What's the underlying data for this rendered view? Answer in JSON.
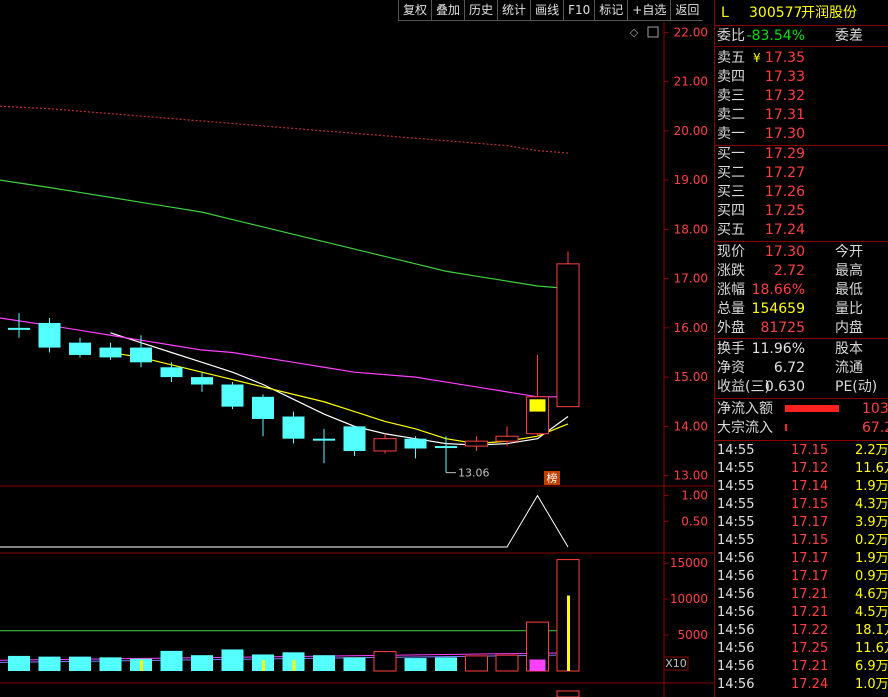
{
  "toolbar": {
    "items": [
      "复权",
      "叠加",
      "历史",
      "统计",
      "画线",
      "F10",
      "标记",
      "+自选",
      "返回"
    ]
  },
  "stock": {
    "flag": "L",
    "code": "300577",
    "name": "开润股份"
  },
  "order_ratio": {
    "label": "委比",
    "value": "-83.54%",
    "label2": "委差"
  },
  "asks": [
    {
      "label": "卖五",
      "mark": "¥",
      "price": "17.35"
    },
    {
      "label": "卖四",
      "price": "17.33"
    },
    {
      "label": "卖三",
      "price": "17.32"
    },
    {
      "label": "卖二",
      "price": "17.31"
    },
    {
      "label": "卖一",
      "price": "17.30"
    }
  ],
  "bids": [
    {
      "label": "买一",
      "price": "17.29"
    },
    {
      "label": "买二",
      "price": "17.27"
    },
    {
      "label": "买三",
      "price": "17.26"
    },
    {
      "label": "买四",
      "price": "17.25"
    },
    {
      "label": "买五",
      "price": "17.24"
    }
  ],
  "quote": [
    {
      "label": "现价",
      "value": "17.30",
      "label2": "今开",
      "color": "red"
    },
    {
      "label": "涨跌",
      "value": "2.72",
      "label2": "最高",
      "color": "red"
    },
    {
      "label": "涨幅",
      "value": "18.66%",
      "label2": "最低",
      "color": "red"
    },
    {
      "label": "总量",
      "value": "154659",
      "label2": "量比",
      "color": "yellow"
    },
    {
      "label": "外盘",
      "value": "81725",
      "label2": "内盘",
      "color": "red"
    }
  ],
  "fundamentals": [
    {
      "label": "换手",
      "value": "11.96%",
      "label2": "股本"
    },
    {
      "label": "净资",
      "value": "6.72",
      "label2": "流通"
    },
    {
      "label": "收益(三)",
      "value": "0.630",
      "label2": "PE(动)"
    }
  ],
  "flows": [
    {
      "label": "净流入额",
      "value": "103"
    },
    {
      "label": "大宗流入",
      "value": "67.2"
    }
  ],
  "ticks": [
    {
      "time": "14:55",
      "price": "17.15",
      "vol": "2.2万"
    },
    {
      "time": "14:55",
      "price": "17.12",
      "vol": "11.6万"
    },
    {
      "time": "14:55",
      "price": "17.14",
      "vol": "1.9万"
    },
    {
      "time": "14:55",
      "price": "17.15",
      "vol": "4.3万"
    },
    {
      "time": "14:55",
      "price": "17.17",
      "vol": "3.9万"
    },
    {
      "time": "14:55",
      "price": "17.15",
      "vol": "0.2万"
    },
    {
      "time": "14:56",
      "price": "17.17",
      "vol": "1.9万"
    },
    {
      "time": "14:56",
      "price": "17.17",
      "vol": "0.9万"
    },
    {
      "time": "14:56",
      "price": "17.21",
      "vol": "4.6万"
    },
    {
      "time": "14:56",
      "price": "17.21",
      "vol": "4.5万"
    },
    {
      "time": "14:56",
      "price": "17.22",
      "vol": "18.1万"
    },
    {
      "time": "14:56",
      "price": "17.25",
      "vol": "11.6万"
    },
    {
      "time": "14:56",
      "price": "17.21",
      "vol": "6.9万"
    },
    {
      "time": "14:56",
      "price": "17.24",
      "vol": "1.0万"
    }
  ],
  "chart_data": {
    "type": "candlestick",
    "price_axis": {
      "ticks": [
        22.0,
        21.0,
        20.0,
        19.0,
        18.0,
        17.0,
        16.0,
        15.0,
        14.0,
        13.0
      ],
      "range": [
        12.85,
        22.15
      ]
    },
    "low_annotation": "13.06",
    "badge": "榜",
    "candles": [
      {
        "o": 16.0,
        "c": 16.0,
        "h": 16.3,
        "l": 15.8,
        "up": false
      },
      {
        "o": 16.1,
        "c": 15.6,
        "h": 16.2,
        "l": 15.5,
        "up": false
      },
      {
        "o": 15.7,
        "c": 15.45,
        "h": 15.8,
        "l": 15.4,
        "up": false
      },
      {
        "o": 15.6,
        "c": 15.4,
        "h": 15.7,
        "l": 15.35,
        "up": false
      },
      {
        "o": 15.6,
        "c": 15.3,
        "h": 15.85,
        "l": 15.2,
        "up": false
      },
      {
        "o": 15.2,
        "c": 15.0,
        "h": 15.3,
        "l": 14.9,
        "up": false
      },
      {
        "o": 15.0,
        "c": 14.85,
        "h": 15.1,
        "l": 14.7,
        "up": false
      },
      {
        "o": 14.85,
        "c": 14.4,
        "h": 14.9,
        "l": 14.35,
        "up": false
      },
      {
        "o": 14.6,
        "c": 14.15,
        "h": 14.65,
        "l": 13.8,
        "up": false
      },
      {
        "o": 14.2,
        "c": 13.75,
        "h": 14.3,
        "l": 13.65,
        "up": false
      },
      {
        "o": 13.75,
        "c": 13.75,
        "h": 13.95,
        "l": 13.25,
        "up": false
      },
      {
        "o": 14.0,
        "c": 13.5,
        "h": 14.0,
        "l": 13.4,
        "up": false
      },
      {
        "o": 13.5,
        "c": 13.75,
        "h": 13.85,
        "l": 13.45,
        "up": true
      },
      {
        "o": 13.75,
        "c": 13.55,
        "h": 13.8,
        "l": 13.35,
        "up": false
      },
      {
        "o": 13.6,
        "c": 13.6,
        "h": 13.8,
        "l": 13.06,
        "up": false
      },
      {
        "o": 13.6,
        "c": 13.7,
        "h": 13.8,
        "l": 13.5,
        "up": true
      },
      {
        "o": 13.7,
        "c": 13.8,
        "h": 14.0,
        "l": 13.6,
        "up": true
      },
      {
        "o": 13.85,
        "c": 14.6,
        "h": 15.45,
        "l": 13.8,
        "up": true
      },
      {
        "o": 14.4,
        "c": 17.3,
        "h": 17.55,
        "l": 14.4,
        "up": true
      }
    ],
    "ma": [
      {
        "name": "MA-white",
        "color": "#ffffff",
        "values": [
          null,
          null,
          null,
          15.9,
          15.7,
          15.5,
          15.3,
          15.1,
          14.85,
          14.55,
          14.25,
          14.0,
          13.85,
          13.75,
          13.65,
          13.62,
          13.65,
          13.75,
          14.2
        ]
      },
      {
        "name": "MA-yellow",
        "color": "#ffff00",
        "values": [
          null,
          null,
          null,
          15.5,
          15.4,
          15.25,
          15.1,
          14.95,
          14.8,
          14.65,
          14.5,
          14.3,
          14.1,
          13.95,
          13.75,
          13.65,
          13.7,
          13.8,
          14.05
        ]
      },
      {
        "name": "MA-magenta",
        "color": "#ff40ff",
        "values": [
          16.2,
          16.05,
          15.95,
          15.85,
          15.75,
          15.65,
          15.55,
          15.5,
          15.4,
          15.3,
          15.2,
          15.1,
          15.05,
          15.0,
          14.9,
          14.8,
          14.7,
          14.6,
          14.6
        ]
      },
      {
        "name": "MA-green",
        "color": "#40d040",
        "values": [
          19.0,
          18.85,
          18.75,
          18.65,
          18.55,
          18.45,
          18.35,
          18.2,
          18.05,
          17.9,
          17.75,
          17.6,
          17.45,
          17.3,
          17.15,
          17.05,
          16.95,
          16.85,
          16.8
        ]
      },
      {
        "name": "MA-red",
        "color": "#c03030",
        "values": [
          20.5,
          20.45,
          20.4,
          20.35,
          20.3,
          20.25,
          20.2,
          20.15,
          20.1,
          20.05,
          20.0,
          19.95,
          19.9,
          19.85,
          19.8,
          19.75,
          19.7,
          19.6,
          19.55
        ]
      }
    ],
    "indicator": {
      "ticks": [
        1.0,
        0.5
      ],
      "values": [
        0,
        0,
        0,
        0,
        0,
        0,
        0,
        0,
        0,
        0,
        0,
        0,
        0,
        0,
        0,
        0,
        0,
        1.0,
        0
      ]
    },
    "volume": {
      "ticks": [
        15000,
        10000,
        5000
      ],
      "unit": "X10",
      "max": 16000,
      "values": [
        2100,
        2000,
        2000,
        1900,
        1700,
        2800,
        2200,
        3000,
        2300,
        2600,
        2200,
        1900,
        2700,
        1800,
        1900,
        2100,
        2200,
        6800,
        15500
      ],
      "up": [
        false,
        false,
        false,
        false,
        false,
        false,
        false,
        false,
        false,
        false,
        false,
        false,
        true,
        false,
        false,
        true,
        true,
        true,
        true
      ]
    }
  }
}
